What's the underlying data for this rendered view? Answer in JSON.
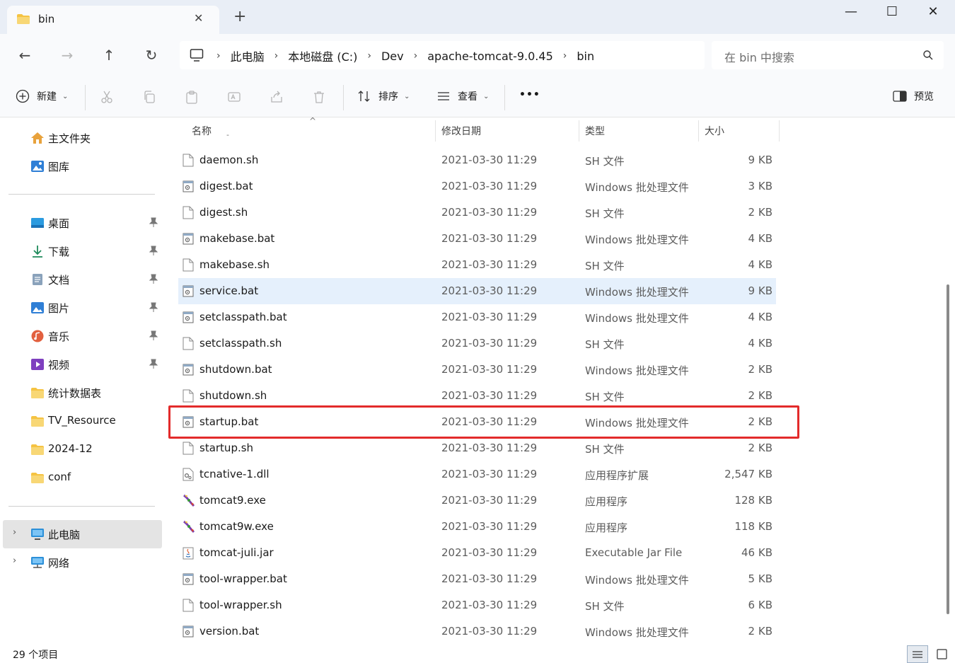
{
  "window": {
    "tab_title": "bin",
    "tab_close": "✕",
    "new_tab": "+",
    "minimize": "—",
    "maximize": "☐",
    "close": "✕"
  },
  "nav": {
    "back": "←",
    "forward": "→",
    "up": "↑",
    "refresh": "↻"
  },
  "breadcrumbs": [
    "此电脑",
    "本地磁盘 (C:)",
    "Dev",
    "apache-tomcat-9.0.45",
    "bin"
  ],
  "crumb_sep": "›",
  "search": {
    "placeholder": "在 bin 中搜索"
  },
  "toolbar": {
    "new_label": "新建",
    "sort_label": "排序",
    "view_label": "查看",
    "more_label": "•••",
    "preview_label": "预览",
    "chev": "⌄"
  },
  "sidebar": {
    "quick": [
      {
        "label": "主文件夹",
        "icon": "home-icon"
      },
      {
        "label": "图库",
        "icon": "gallery-icon"
      }
    ],
    "pinned": [
      {
        "label": "桌面",
        "icon": "desktop-icon",
        "pinned": true
      },
      {
        "label": "下载",
        "icon": "download-icon",
        "pinned": true
      },
      {
        "label": "文档",
        "icon": "document-icon",
        "pinned": true
      },
      {
        "label": "图片",
        "icon": "pictures-icon",
        "pinned": true
      },
      {
        "label": "音乐",
        "icon": "music-icon",
        "pinned": true
      },
      {
        "label": "视频",
        "icon": "video-icon",
        "pinned": true
      },
      {
        "label": "统计数据表",
        "icon": "folder-icon",
        "pinned": false
      },
      {
        "label": "TV_Resource",
        "icon": "folder-icon",
        "pinned": false
      },
      {
        "label": "2024-12",
        "icon": "folder-icon",
        "pinned": false
      },
      {
        "label": "conf",
        "icon": "folder-icon",
        "pinned": false
      }
    ],
    "devices": [
      {
        "label": "此电脑",
        "icon": "computer-icon",
        "selected": true
      },
      {
        "label": "网络",
        "icon": "network-icon",
        "selected": false
      }
    ],
    "pin_glyph": "📌",
    "expand_glyph": "›"
  },
  "columns": {
    "name": "名称",
    "date": "修改日期",
    "type": "类型",
    "size": "大小",
    "sort_indicator": "^",
    "name_sub": "-"
  },
  "files": [
    {
      "name": "daemon.sh",
      "date": "2021-03-30 11:29",
      "type": "SH 文件",
      "size": "9 KB",
      "icon": "blank"
    },
    {
      "name": "digest.bat",
      "date": "2021-03-30 11:29",
      "type": "Windows 批处理文件",
      "size": "3 KB",
      "icon": "bat"
    },
    {
      "name": "digest.sh",
      "date": "2021-03-30 11:29",
      "type": "SH 文件",
      "size": "2 KB",
      "icon": "blank"
    },
    {
      "name": "makebase.bat",
      "date": "2021-03-30 11:29",
      "type": "Windows 批处理文件",
      "size": "4 KB",
      "icon": "bat"
    },
    {
      "name": "makebase.sh",
      "date": "2021-03-30 11:29",
      "type": "SH 文件",
      "size": "4 KB",
      "icon": "blank"
    },
    {
      "name": "service.bat",
      "date": "2021-03-30 11:29",
      "type": "Windows 批处理文件",
      "size": "9 KB",
      "icon": "bat",
      "hover": true
    },
    {
      "name": "setclasspath.bat",
      "date": "2021-03-30 11:29",
      "type": "Windows 批处理文件",
      "size": "4 KB",
      "icon": "bat"
    },
    {
      "name": "setclasspath.sh",
      "date": "2021-03-30 11:29",
      "type": "SH 文件",
      "size": "4 KB",
      "icon": "blank"
    },
    {
      "name": "shutdown.bat",
      "date": "2021-03-30 11:29",
      "type": "Windows 批处理文件",
      "size": "2 KB",
      "icon": "bat"
    },
    {
      "name": "shutdown.sh",
      "date": "2021-03-30 11:29",
      "type": "SH 文件",
      "size": "2 KB",
      "icon": "blank"
    },
    {
      "name": "startup.bat",
      "date": "2021-03-30 11:29",
      "type": "Windows 批处理文件",
      "size": "2 KB",
      "icon": "bat",
      "highlighted": true
    },
    {
      "name": "startup.sh",
      "date": "2021-03-30 11:29",
      "type": "SH 文件",
      "size": "2 KB",
      "icon": "blank"
    },
    {
      "name": "tcnative-1.dll",
      "date": "2021-03-30 11:29",
      "type": "应用程序扩展",
      "size": "2,547 KB",
      "icon": "dll"
    },
    {
      "name": "tomcat9.exe",
      "date": "2021-03-30 11:29",
      "type": "应用程序",
      "size": "128 KB",
      "icon": "exe"
    },
    {
      "name": "tomcat9w.exe",
      "date": "2021-03-30 11:29",
      "type": "应用程序",
      "size": "118 KB",
      "icon": "exe"
    },
    {
      "name": "tomcat-juli.jar",
      "date": "2021-03-30 11:29",
      "type": "Executable Jar File",
      "size": "46 KB",
      "icon": "jar"
    },
    {
      "name": "tool-wrapper.bat",
      "date": "2021-03-30 11:29",
      "type": "Windows 批处理文件",
      "size": "5 KB",
      "icon": "bat"
    },
    {
      "name": "tool-wrapper.sh",
      "date": "2021-03-30 11:29",
      "type": "SH 文件",
      "size": "6 KB",
      "icon": "blank"
    },
    {
      "name": "version.bat",
      "date": "2021-03-30 11:29",
      "type": "Windows 批处理文件",
      "size": "2 KB",
      "icon": "bat"
    }
  ],
  "status": {
    "item_count": "29 个项目"
  },
  "colors": {
    "accent": "#0067c0",
    "hover_row": "#e5f0fc",
    "highlight_box": "#e32b2b",
    "folder": "#f5c342",
    "titlebar": "#e9eef6"
  }
}
